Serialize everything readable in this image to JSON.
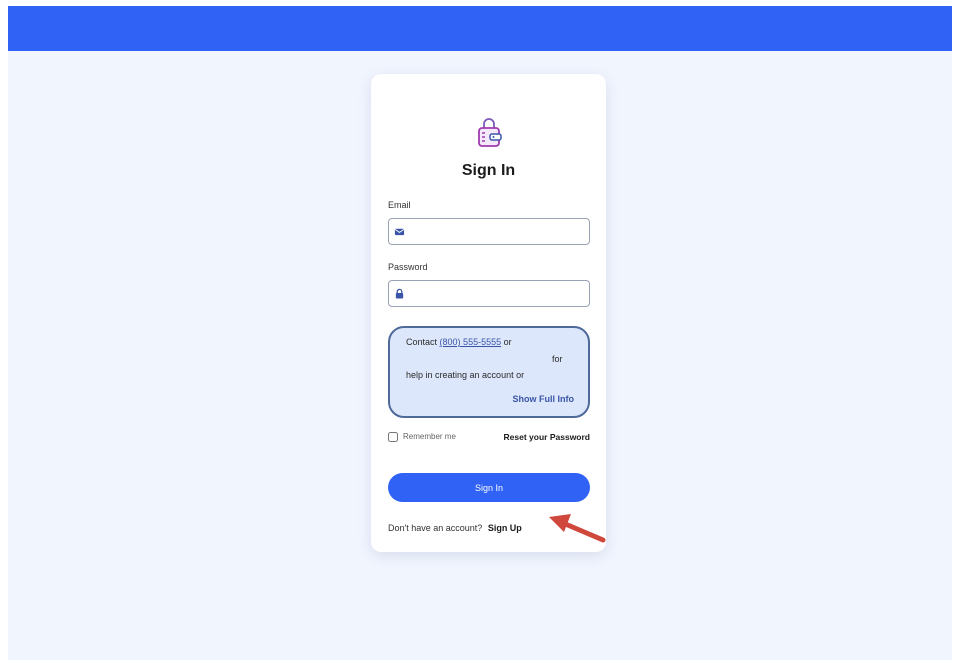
{
  "form": {
    "title": "Sign In",
    "email_label": "Email",
    "email_value": "",
    "email_placeholder": "",
    "password_label": "Password",
    "password_value": "",
    "password_placeholder": ""
  },
  "info": {
    "contact_prefix": "Contact",
    "phone": "(800) 555-5555",
    "contact_suffix": "or",
    "for_text": "for",
    "help_text": "help in creating an account or",
    "show_full": "Show Full Info"
  },
  "options": {
    "remember_label": "Remember me",
    "remember_checked": false,
    "reset_label": "Reset your Password"
  },
  "actions": {
    "signin_label": "Sign In",
    "no_account_text": "Don't have an account?",
    "signup_label": "Sign Up"
  },
  "icons": {
    "logo": "wallet-lock-icon",
    "email": "envelope-icon",
    "password": "lock-icon",
    "annotation": "red-arrow-icon"
  },
  "colors": {
    "primary": "#2f62f5",
    "background": "#f1f5fe",
    "info_bg": "#dde7fb",
    "info_border": "#4e6a9a",
    "link": "#3a55a8",
    "annotation_arrow": "#d0473c"
  }
}
